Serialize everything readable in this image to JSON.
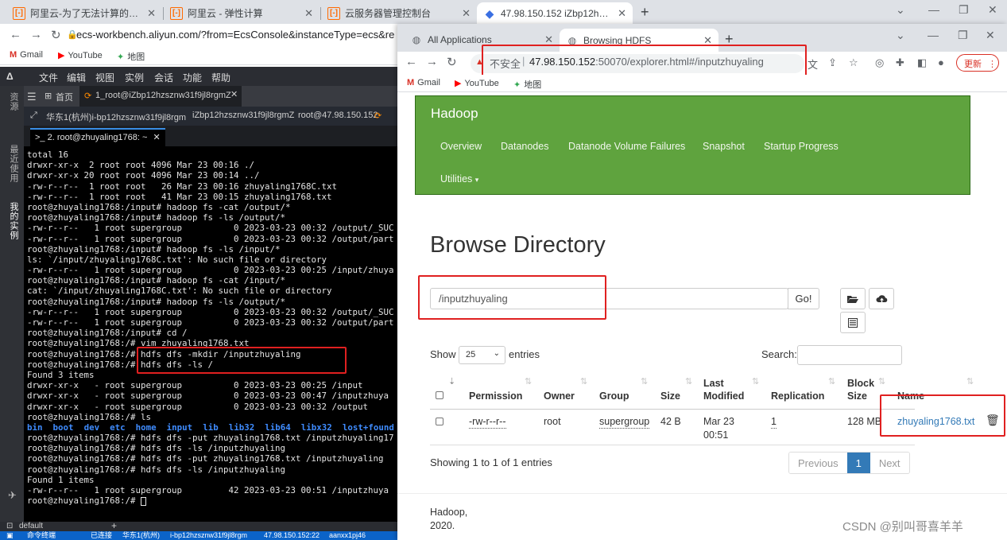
{
  "bg_browser": {
    "tabs": [
      {
        "title": "阿里云-为了无法计算的价值"
      },
      {
        "title": "阿里云 - 弹性计算"
      },
      {
        "title": "云服务器管理控制台"
      },
      {
        "title": "47.98.150.152 iZbp12hzsznw3"
      }
    ],
    "url": "ecs-workbench.aliyun.com/?from=EcsConsole&instanceType=ecs&re",
    "bookmarks": [
      "Gmail",
      "YouTube",
      "地图"
    ]
  },
  "workbench": {
    "menu": [
      "文件",
      "编辑",
      "视图",
      "实例",
      "会话",
      "功能",
      "帮助"
    ],
    "left_labels": [
      "资源",
      "最近使用",
      "我的实例"
    ],
    "home_tab": "首页",
    "session_tab": "1_root@iZbp12hzsznw31f9jl8rgmZ",
    "info_bar": [
      "华东1(杭州)i-bp12hzsznw31f9jl8rgm",
      "iZbp12hzsznw31f9jl8rgmZ",
      "root@47.98.150.152"
    ],
    "terminal_tab": "2. root@zhuyaling1768: ~",
    "terminal_lines": [
      "total 16",
      "drwxr-xr-x  2 root root 4096 Mar 23 00:16 ./",
      "drwxr-xr-x 20 root root 4096 Mar 23 00:14 ../",
      "-rw-r--r--  1 root root   26 Mar 23 00:16 zhuyaling1768C.txt",
      "-rw-r--r--  1 root root   41 Mar 23 00:15 zhuyaling1768.txt",
      "root@zhuyaling1768:/input# hadoop fs -cat /output/*",
      "root@zhuyaling1768:/input# hadoop fs -ls /output/*",
      "-rw-r--r--   1 root supergroup          0 2023-03-23 00:32 /output/_SUC",
      "-rw-r--r--   1 root supergroup          0 2023-03-23 00:32 /output/part",
      "root@zhuyaling1768:/input# hadoop fs -ls /input/*",
      "ls: `/input/zhuyaling1768C.txt': No such file or directory",
      "-rw-r--r--   1 root supergroup          0 2023-03-23 00:25 /input/zhuya",
      "root@zhuyaling1768:/input# hadoop fs -cat /input/*",
      "cat: `/input/zhuyaling1768C.txt': No such file or directory",
      "root@zhuyaling1768:/input# hadoop fs -ls /output/*",
      "-rw-r--r--   1 root supergroup          0 2023-03-23 00:32 /output/_SUC",
      "-rw-r--r--   1 root supergroup          0 2023-03-23 00:32 /output/part",
      "root@zhuyaling1768:/input# cd /",
      "root@zhuyaling1768:/# vim zhuyaling1768.txt",
      "root@zhuyaling1768:/# hdfs dfs -mkdir /inputzhuyaling",
      "root@zhuyaling1768:/# hdfs dfs -ls /",
      "Found 3 items",
      "drwxr-xr-x   - root supergroup          0 2023-03-23 00:25 /input",
      "drwxr-xr-x   - root supergroup          0 2023-03-23 00:47 /inputzhuya",
      "drwxr-xr-x   - root supergroup          0 2023-03-23 00:32 /output",
      "root@zhuyaling1768:/# ls",
      "root@zhuyaling1768:/# hdfs dfs -put zhuyaling1768.txt /inputzhuyaling17",
      "root@zhuyaling1768:/# hdfs dfs -ls /inputzhuyaling",
      "root@zhuyaling1768:/# hdfs dfs -put zhuyaling1768.txt /inputzhuyaling",
      "root@zhuyaling1768:/# hdfs dfs -ls /inputzhuyaling",
      "Found 1 items",
      "-rw-r--r--   1 root supergroup         42 2023-03-23 00:51 /inputzhuya",
      "root@zhuyaling1768:/# "
    ],
    "ls_output": [
      "bin",
      "boot",
      "dev",
      "etc",
      "home",
      "input",
      "lib",
      "lib32",
      "lib64",
      "libx32",
      "lost+found"
    ],
    "status_default": "default",
    "status_items": [
      "命令终端",
      "已连接",
      "华东1(杭州)",
      "i-bp12hzsznw31f9jl8rgm",
      "47.98.150.152:22",
      "aanxx1pj46"
    ]
  },
  "fg_browser": {
    "tabs": [
      {
        "title": "All Applications"
      },
      {
        "title": "Browsing HDFS"
      }
    ],
    "insecure_label": "不安全",
    "url_host": "47.98.150.152",
    "url_rest": ":50070/explorer.html#/inputzhuyaling",
    "update_label": "更新",
    "bookmarks": [
      "Gmail",
      "YouTube",
      "地图"
    ]
  },
  "hadoop": {
    "brand": "Hadoop",
    "nav": [
      "Overview",
      "Datanodes",
      "Datanode Volume Failures",
      "Snapshot",
      "Startup Progress",
      "Utilities"
    ],
    "title": "Browse Directory",
    "dir_value": "/inputzhuyaling",
    "go_label": "Go!",
    "show_label": "Show",
    "show_value": "25",
    "entries_label": "entries",
    "search_label": "Search:",
    "columns": [
      "Permission",
      "Owner",
      "Group",
      "Size",
      "Last Modified",
      "Replication",
      "Block Size",
      "Name"
    ],
    "rows": [
      {
        "permission": "-rw-r--r--",
        "owner": "root",
        "group": "supergroup",
        "size": "42 B",
        "modified_date": "Mar 23",
        "modified_time": "00:51",
        "replication": "1",
        "block_size": "128 MB",
        "name": "zhuyaling1768.txt"
      }
    ],
    "info": "Showing 1 to 1 of 1 entries",
    "pager": [
      "Previous",
      "1",
      "Next"
    ],
    "footer_line1": "Hadoop,",
    "footer_line2": "2020."
  },
  "watermark": "CSDN @别叫哥喜羊羊"
}
